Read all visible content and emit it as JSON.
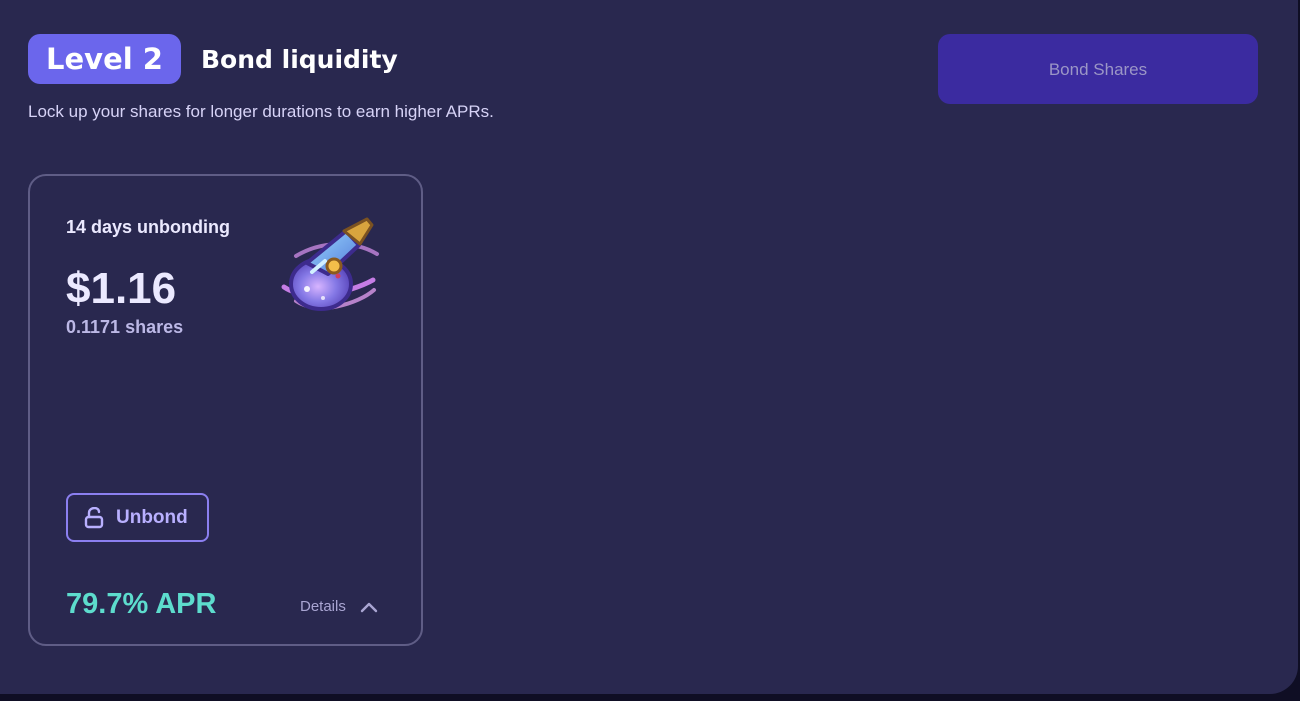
{
  "header": {
    "level_label": "Level 2",
    "title": "Bond liquidity",
    "subtitle": "Lock up your shares for longer durations to earn higher APRs.",
    "bond_button_label": "Bond Shares"
  },
  "card": {
    "title": "14 days unbonding",
    "value": "$1.16",
    "shares": "0.1171 shares",
    "unbond_label": "Unbond",
    "apr": "79.7% APR",
    "details_label": "Details",
    "icon_names": [
      "potion-icon",
      "unlock-icon",
      "chevron-up-icon"
    ]
  },
  "colors": {
    "background": "#29284f",
    "accent": "#6b66ec",
    "button": "#3b2ba0",
    "apr": "#5ddccd"
  }
}
